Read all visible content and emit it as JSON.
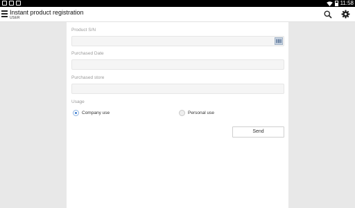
{
  "status_bar": {
    "time": "11:58",
    "icons": [
      "notification-icon",
      "notification-icon",
      "notification-icon",
      "wifi-icon",
      "battery-icon"
    ]
  },
  "app_bar": {
    "title": "Instant product registration",
    "subtitle": "USER",
    "icons": [
      "menu-icon",
      "search-icon",
      "settings-icon"
    ]
  },
  "form": {
    "product_sn": {
      "label": "Product S/N",
      "value": "",
      "icon": "barcode-scan-icon"
    },
    "purchased_date": {
      "label": "Purchased Date",
      "value": ""
    },
    "purchased_store": {
      "label": "Purchased store",
      "value": ""
    },
    "usage": {
      "label": "Usage",
      "options": [
        "Company use",
        "Personal use"
      ],
      "selected": "Company use"
    },
    "send_label": "Send"
  },
  "colors": {
    "accent": "#3d7fd1",
    "panel_background": "#ffffff",
    "page_background": "#e8e8e8"
  }
}
